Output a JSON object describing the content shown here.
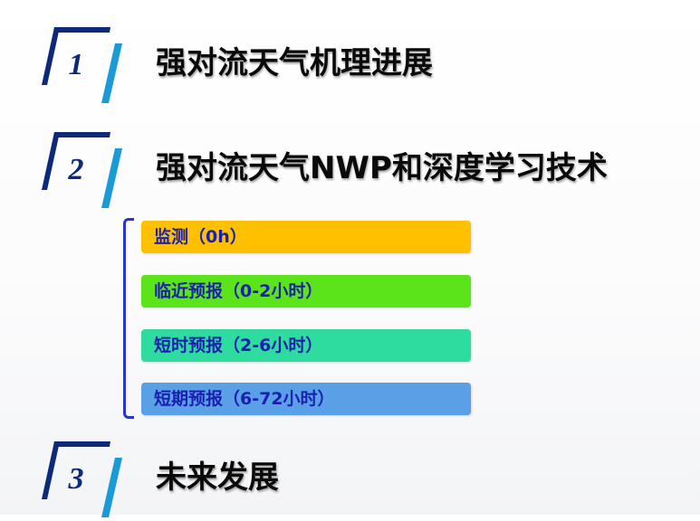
{
  "sections": [
    {
      "number": "1",
      "title": "强对流天气机理进展"
    },
    {
      "number": "2",
      "title": "强对流天气NWP和深度学习技术"
    },
    {
      "number": "3",
      "title": "未来发展"
    }
  ],
  "subitems": [
    {
      "label": "监测（0h）",
      "color": "#ffc000"
    },
    {
      "label": "临近预报（0-2小时）",
      "color": "#5ce41a"
    },
    {
      "label": "短时预报（2-6小时）",
      "color": "#2edc9f"
    },
    {
      "label": "短期预报（6-72小时）",
      "color": "#5aa0e6"
    }
  ],
  "colors": {
    "marker_dark": "#0c2a78",
    "marker_cyan": "#1a9ad6",
    "bracket": "#2a36c8",
    "item_text": "#1b1fb0"
  }
}
